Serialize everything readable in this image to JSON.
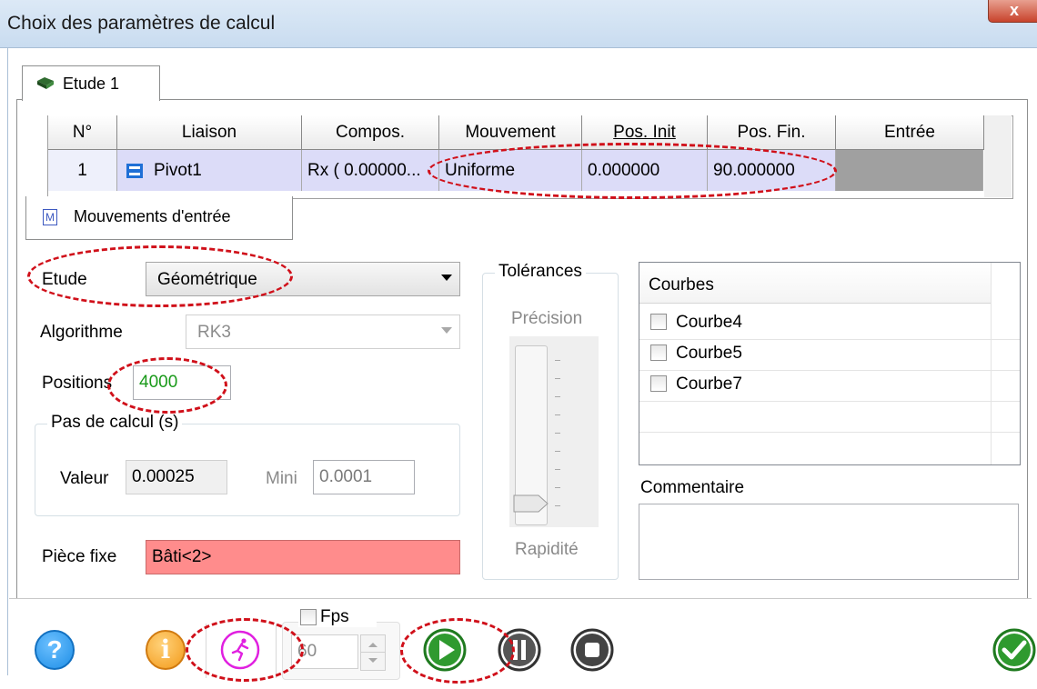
{
  "window": {
    "title": "Choix des paramètres de calcul",
    "close_label": "x"
  },
  "tab": {
    "label": "Etude 1"
  },
  "grid": {
    "headers": [
      "N°",
      "Liaison",
      "Compos.",
      "Mouvement",
      "Pos. Init",
      "Pos. Fin.",
      "Entrée"
    ],
    "rows": [
      {
        "num": "1",
        "liaison": "Pivot1",
        "compos": "Rx ( 0.00000...",
        "mouvement": "Uniforme",
        "pos_init": "0.000000",
        "pos_fin": "90.000000",
        "entree": ""
      }
    ]
  },
  "bottom_tab": {
    "icon_letter": "M",
    "label": "Mouvements d'entrée"
  },
  "form": {
    "etude_label": "Etude",
    "etude_value": "Géométrique",
    "algorithme_label": "Algorithme",
    "algorithme_value": "RK3",
    "positions_label": "Positions",
    "positions_value": "4000",
    "pas_label": "Pas de calcul (s)",
    "valeur_label": "Valeur",
    "valeur_value": "0.00025",
    "mini_label": "Mini",
    "mini_value": "0.0001",
    "piece_label": "Pièce fixe",
    "piece_value": "Bâti<2>"
  },
  "tolerances": {
    "legend": "Tolérances",
    "precision_label": "Précision",
    "rapidite_label": "Rapidité",
    "slider_level": 0
  },
  "courbes": {
    "header": "Courbes",
    "items": [
      "Courbe4",
      "Courbe5",
      "Courbe7"
    ]
  },
  "commentaire": {
    "label": "Commentaire",
    "value": ""
  },
  "toolbar": {
    "fps_label": "Fps",
    "fps_value": "60",
    "help_glyph": "?",
    "info_glyph": "i"
  },
  "colors": {
    "highlight_red": "#d0101a",
    "row_selected": "#dcdcf8",
    "positions_text": "#1a9a1a",
    "piece_bg": "#ff8c8c",
    "play_green": "#2f9a2f",
    "anim_magenta": "#e020e0",
    "help_blue": "#1e8ee6",
    "info_orange": "#f39a1a"
  }
}
